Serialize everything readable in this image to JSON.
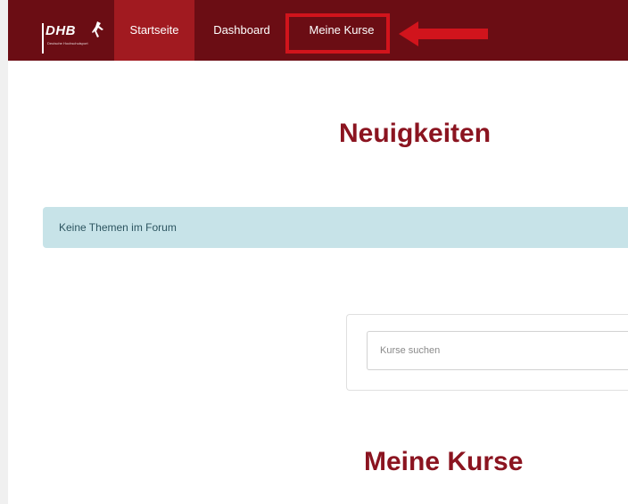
{
  "navbar": {
    "logo_text": "DHB",
    "logo_subtitle": "Deutsche Hochschulsport",
    "items": [
      {
        "label": "Startseite"
      },
      {
        "label": "Dashboard"
      },
      {
        "label": "Meine Kurse"
      }
    ]
  },
  "main": {
    "news_title": "Neuigkeiten",
    "forum_notice": "Keine Themen im Forum",
    "search": {
      "placeholder": "Kurse suchen"
    },
    "courses_title": "Meine Kurse"
  },
  "colors": {
    "navbar": "#6b0d14",
    "active_item": "#a11a20",
    "highlight": "#d1141c",
    "title": "#8b1420",
    "alert_bg": "#c7e3e8"
  }
}
